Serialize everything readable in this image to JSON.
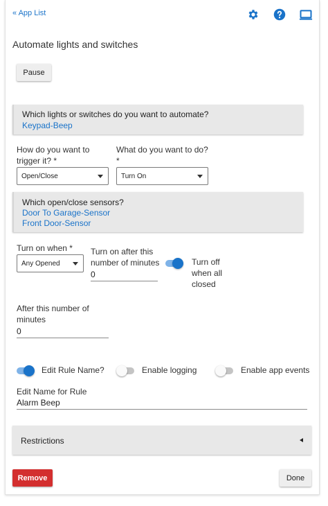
{
  "nav": {
    "back_link": "« App List",
    "icons": [
      "gear-icon",
      "help-icon",
      "laptop-icon"
    ]
  },
  "page_title": "Automate lights and switches",
  "pause_button": "Pause",
  "switches_panel": {
    "question": "Which lights or switches do you want to automate?",
    "value": "Keypad-Beep"
  },
  "trigger": {
    "label": "How do you want to trigger it? *",
    "selected": "Open/Close"
  },
  "action": {
    "label": "What do you want to do? *",
    "selected": "Turn On"
  },
  "sensors_panel": {
    "question": "Which open/close sensors?",
    "values": [
      "Door To Garage-Sensor",
      "Front Door-Sensor"
    ]
  },
  "turn_on_when": {
    "label": "Turn on when *",
    "selected": "Any Opened"
  },
  "turn_on_after": {
    "label": "Turn on after this number of minutes",
    "value": "0"
  },
  "turn_off_toggle": {
    "label": "Turn off when all closed",
    "on": true
  },
  "after_minutes": {
    "label": "After this number of minutes",
    "value": "0"
  },
  "toggles": [
    {
      "label": "Edit Rule Name?",
      "on": true
    },
    {
      "label": "Enable logging",
      "on": false
    },
    {
      "label": "Enable app events",
      "on": false
    }
  ],
  "rule_name": {
    "label": "Edit Name for Rule",
    "value": "Alarm Beep"
  },
  "restrictions": "Restrictions",
  "remove_button": "Remove",
  "done_button": "Done",
  "colors": {
    "accent": "#1a73c9",
    "danger": "#d32f2f",
    "panel": "#e8e8e8"
  }
}
